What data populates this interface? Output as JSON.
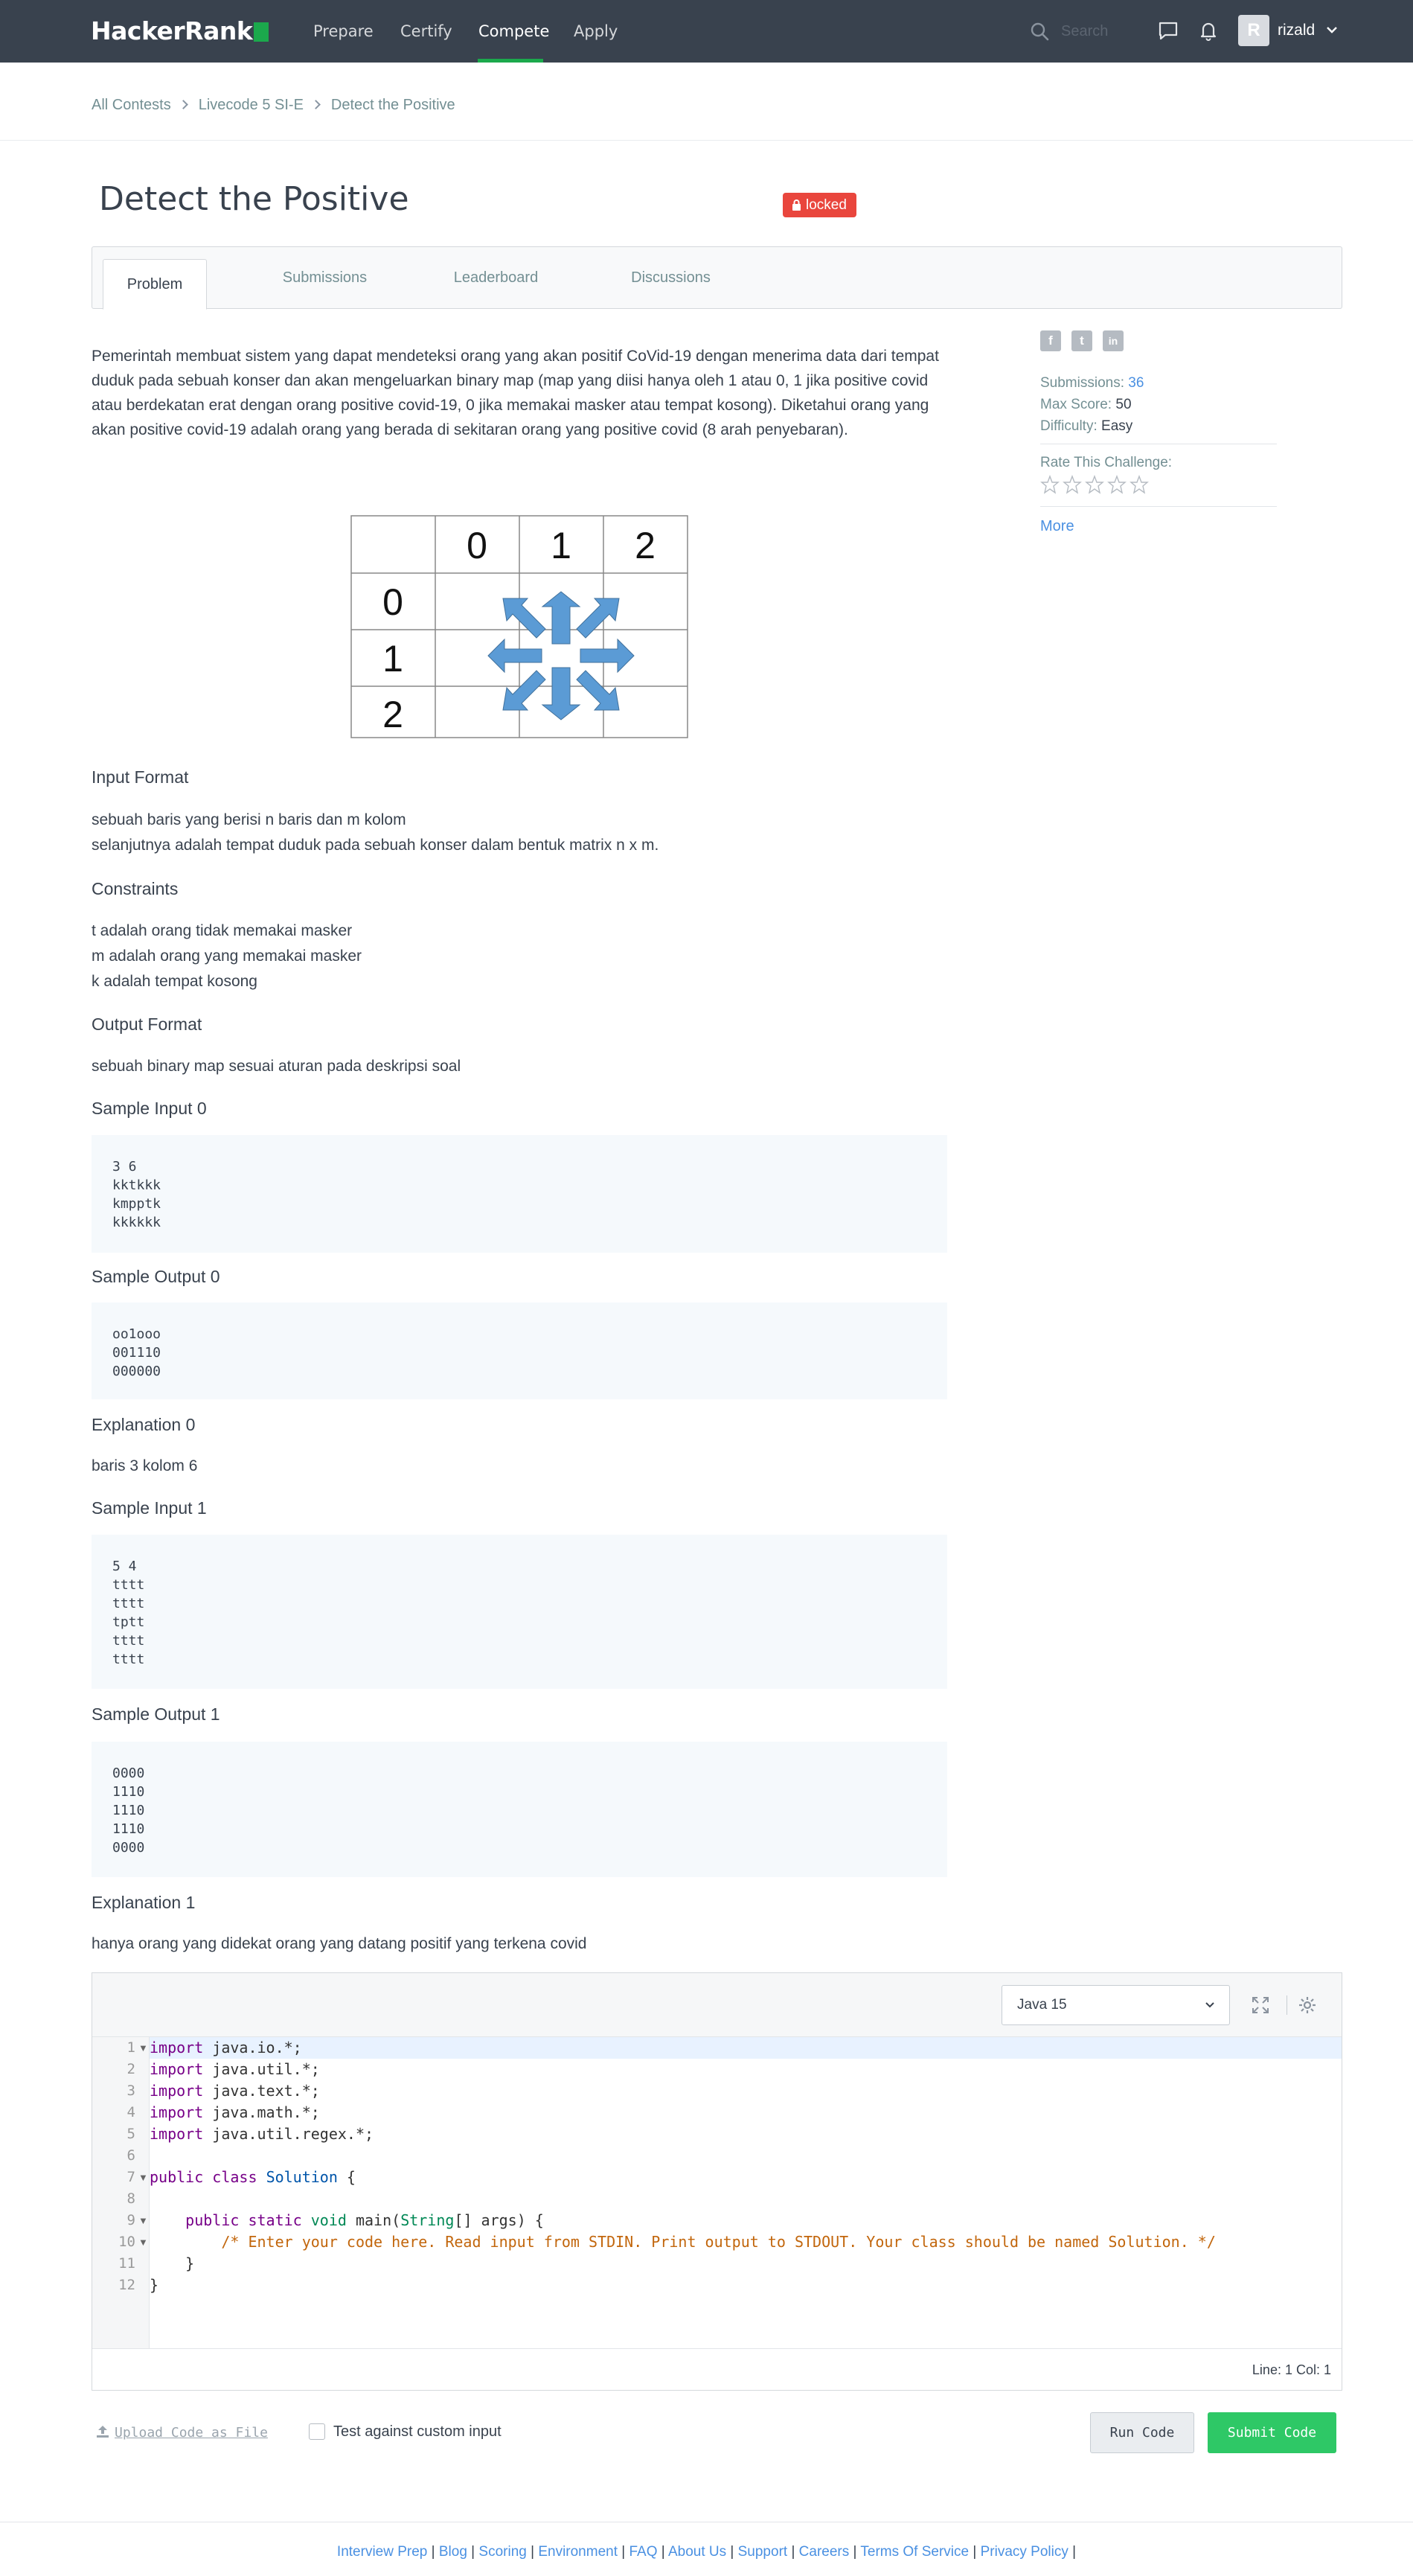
{
  "colors": {
    "nav_bg": "#39424e",
    "brand_green": "#1ba94c",
    "locked_red": "#e9463d",
    "link_blue": "#4a90e2",
    "submit_green": "#2ec866"
  },
  "nav": {
    "logo": "HackerRank",
    "items": [
      "Prepare",
      "Certify",
      "Compete",
      "Apply"
    ],
    "active_item": "Compete",
    "search_placeholder": "Search",
    "username": "rizald",
    "avatar_letter": "R",
    "icons": [
      "search-icon",
      "messages-icon",
      "notifications-bell-icon",
      "chevron-down-icon"
    ]
  },
  "breadcrumb": [
    "All Contests",
    "Livecode 5 SI-E",
    "Detect the Positive"
  ],
  "challenge": {
    "title": "Detect the Positive",
    "status_badge": "locked"
  },
  "tabs": [
    "Problem",
    "Submissions",
    "Leaderboard",
    "Discussions"
  ],
  "problem": {
    "description": "Pemerintah membuat sistem yang dapat mendeteksi orang yang akan positif CoVid-19 dengan menerima data dari tempat duduk pada sebuah konser dan akan mengeluarkan binary map (map yang diisi hanya oleh 1 atau 0, 1 jika positive covid atau berdekatan erat dengan orang positive covid-19, 0 jika memakai masker atau tempat kosong). Diketahui orang yang akan positive covid-19 adalah orang yang berada di sekitaran orang yang positive covid (8 arah penyebaran).",
    "grid_figure": {
      "col_headers": [
        "0",
        "1",
        "2"
      ],
      "row_headers": [
        "0",
        "1",
        "2"
      ]
    },
    "input_format_title": "Input Format",
    "input_format_line1_pre": "sebuah baris yang berisi ",
    "input_format_line1_n": "n",
    "input_format_line1_mid": " baris dan ",
    "input_format_line1_m": "m",
    "input_format_line1_post": " kolom",
    "input_format_line2_pre": "selanjutnya adalah tempat duduk pada sebuah konser dalam bentuk matrix ",
    "input_format_line2_n": "n",
    "input_format_line2_x": " x ",
    "input_format_line2_m": "m",
    "input_format_line2_post": ".",
    "constraints_title": "Constraints",
    "constraints": [
      {
        "key": "t",
        "text": " adalah orang tidak memakai masker"
      },
      {
        "key": "m",
        "text": " adalah orang yang memakai masker"
      },
      {
        "key": "k",
        "text": " adalah tempat kosong"
      }
    ],
    "output_format_title": "Output Format",
    "output_format": "sebuah binary map sesuai aturan pada deskripsi soal",
    "sample_input_0_title": "Sample Input 0",
    "sample_input_0": "3 6\nkktkkk\nkmpptk\nkkkkkk",
    "sample_output_0_title": "Sample Output 0",
    "sample_output_0": "oo1ooo\n001110\n000000",
    "explanation_0_title": "Explanation 0",
    "explanation_0": "baris 3 kolom 6",
    "sample_input_1_title": "Sample Input 1",
    "sample_input_1": "5 4\ntttt\ntttt\ntptt\ntttt\ntttt",
    "sample_output_1_title": "Sample Output 1",
    "sample_output_1": "0000\n1110\n1110\n1110\n0000",
    "explanation_1_title": "Explanation 1",
    "explanation_1": "hanya orang yang didekat orang yang datang positif yang terkena covid"
  },
  "sidebar": {
    "social": [
      "f",
      "t",
      "in"
    ],
    "submissions_label": "Submissions: ",
    "submissions_value": "36",
    "max_score_label": "Max Score: ",
    "max_score_value": "50",
    "difficulty_label": "Difficulty: ",
    "difficulty_value": "Easy",
    "rate_label": "Rate This Challenge:",
    "rating": 0,
    "rating_max": 5,
    "more_link": "More"
  },
  "editor": {
    "language": "Java 15",
    "code_lines": [
      "import java.io.*;",
      "import java.util.*;",
      "import java.text.*;",
      "import java.math.*;",
      "import java.util.regex.*;",
      "",
      "public class Solution {",
      "",
      "    public static void main(String[] args) {",
      "        /* Enter your code here. Read input from STDIN. Print output to STDOUT. Your class should be named Solution. */",
      "    }",
      "}"
    ],
    "line_numbers": [
      "1",
      "2",
      "3",
      "4",
      "5",
      "6",
      "7",
      "8",
      "9",
      "10",
      "11",
      "12"
    ],
    "cursor_status": "Line: 1 Col: 1"
  },
  "actions": {
    "upload_label": "Upload Code as File",
    "custom_input_label": "Test against custom input",
    "run_label": "Run Code",
    "submit_label": "Submit Code"
  },
  "footer": {
    "links": [
      "Interview Prep",
      "Blog",
      "Scoring",
      "Environment",
      "FAQ",
      "About Us",
      "Support",
      "Careers",
      "Terms Of Service",
      "Privacy Policy"
    ]
  }
}
